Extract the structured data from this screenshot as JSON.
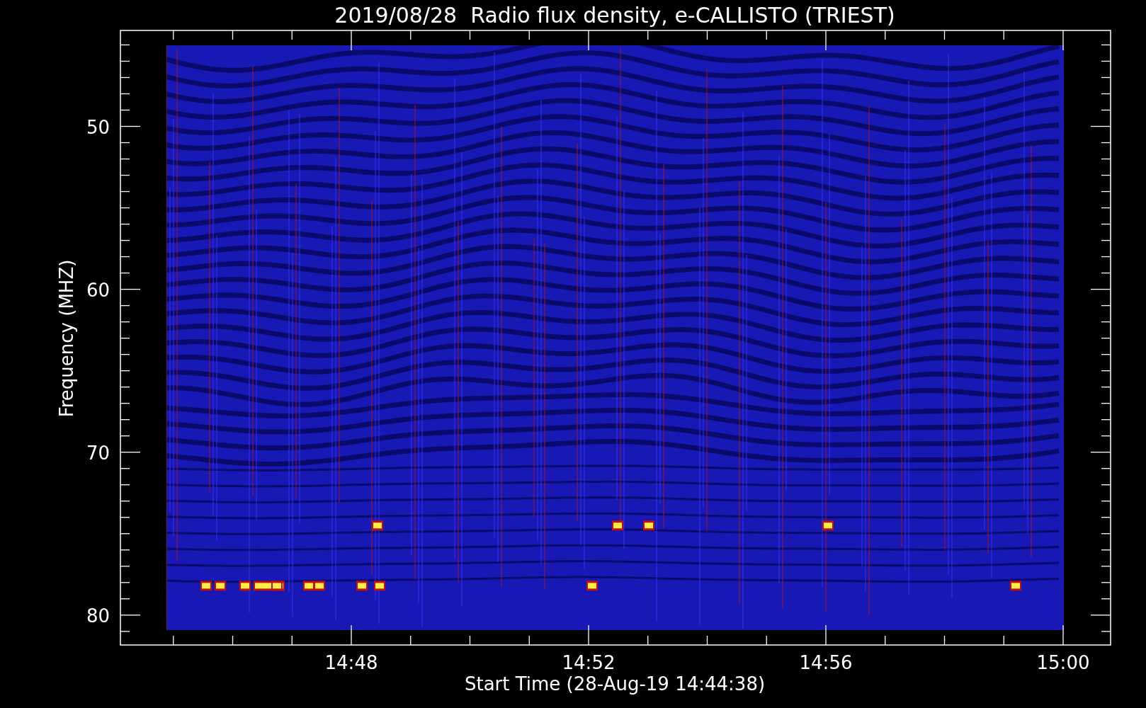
{
  "title": "2019/08/28  Radio flux density, e-CALLISTO (TRIEST)",
  "y_axis": {
    "label": "Frequency (MHZ)",
    "ticks": [
      "50",
      "60",
      "70",
      "80"
    ]
  },
  "x_axis": {
    "label": "Start Time (28-Aug-19 14:44:38)",
    "ticks": [
      "14:48",
      "14:52",
      "14:56",
      "15:00"
    ]
  }
}
